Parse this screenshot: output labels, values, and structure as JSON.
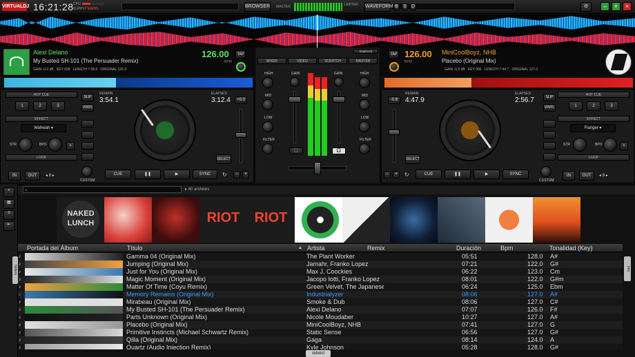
{
  "topbar": {
    "logo": "VIRTUALDJ",
    "clock": "16:21:28",
    "cpu": "CPU",
    "supply": "SUPPLY",
    "mains": "MAINS",
    "browser": "BROWSER",
    "master": "MASTER",
    "limiter": "LIMITER",
    "waveform": "WAVEFORM",
    "b": "B",
    "s": "S",
    "d": "D"
  },
  "deck_left": {
    "artist": "Alexi Delano",
    "title": "My Busted SH-101 (The Persuader Remix)",
    "bpm": "126.00",
    "bpm_label": "BPM",
    "tap": "TAP",
    "gain": "GAIN -0.0 dB",
    "key": "KEY",
    "key_val": "028",
    "length": "LENGTH",
    "length_val": "7:06.6",
    "original": "ORIGINAL",
    "original_val": "126.0",
    "remain_label": "REMAIN",
    "remain": "3:54.1",
    "elapsed_label": "ELAPSED",
    "elapsed": "3:12.4",
    "pitch": "+0.0"
  },
  "deck_right": {
    "artist": "MiniCoolBoyz, NHB",
    "title": "Placebo (Original Mix)",
    "bpm": "126.00",
    "bpm_label": "BPM",
    "tap": "TAP",
    "gain": "GAIN -0.0 dB",
    "key": "KEY",
    "key_val": "096",
    "length": "LENGTH",
    "length_val": "7:44.7",
    "original": "ORIGINAL",
    "original_val": "127.0",
    "remain_label": "REMAIN",
    "remain": "4:47.9",
    "elapsed_label": "ELAPSED",
    "elapsed": "2:56.7",
    "pitch": "-0.8"
  },
  "controls": {
    "hot_cue": "HOT CUE",
    "effect": "EFFECT",
    "loop": "LOOP",
    "slip": "SLIP",
    "vinyl": "VINYL",
    "sync_label": "SYNC",
    "cue": "CUE",
    "in": "IN",
    "out": "OUT",
    "custom": "CUSTOM",
    "select": "SELECT",
    "str": "STR",
    "bpo": "BPO",
    "effect_left": "Wahwah",
    "effect_right": "Flanger",
    "loop_val": "8",
    "hc1": "1",
    "hc2": "2",
    "hc3": "3"
  },
  "mixer": {
    "mixer": "MIXER",
    "video": "VIDEO",
    "scratch": "SCRATCH",
    "master": "MASTER",
    "high": "HIGH",
    "mid": "MID",
    "low": "LOW",
    "filter": "FILTER",
    "gain": "GAIN",
    "sampler": "SAMPLER"
  },
  "browser": {
    "archives": "40 archives",
    "sidelist": "sidelist",
    "folders": "folders",
    "info": "Info"
  },
  "columns": [
    "Portada del Álbum",
    "Título",
    "Artista",
    "Remix",
    "Duración",
    "Bpm",
    "Tonalidad (Key)"
  ],
  "tracks": [
    {
      "title": "Gamma 04 (Original Mix)",
      "artist": "The Plant Worker",
      "dur": "05:51",
      "bpm": "128.0",
      "key": "A#"
    },
    {
      "title": "Jumping (Original Mix)",
      "artist": "Jamahr, Franko Lopez",
      "dur": "07:21",
      "bpm": "122.0",
      "key": "G#"
    },
    {
      "title": "Just for You (Original Mix)",
      "artist": "Max J, Coockies",
      "dur": "06:22",
      "bpm": "123.0",
      "key": "Cm"
    },
    {
      "title": "Magic Moment (Original Mix)",
      "artist": "Jacopo Iotti, Franko Lopez",
      "dur": "08:01",
      "bpm": "122.0",
      "key": "G#m"
    },
    {
      "title": "Matter Of Time (Coyu Remix)",
      "artist": "Green Velvet, The Japanese...",
      "dur": "06:24",
      "bpm": "125.0",
      "key": "Ebm"
    },
    {
      "title": "Memory Remains (Original Mix)",
      "artist": "Industrialyzer",
      "dur": "08:06",
      "bpm": "127.0",
      "key": "A#"
    },
    {
      "title": "Mirabeau (Original Mix)",
      "artist": "Smoke & Dub",
      "dur": "08:06",
      "bpm": "127.0",
      "key": "C#"
    },
    {
      "title": "My Busted SH-101 (The Persuader Remix)",
      "artist": "Alexi Delano",
      "dur": "07:07",
      "bpm": "126.0",
      "key": "F#"
    },
    {
      "title": "Parts Unknown (Original Mix)",
      "artist": "Nicole Moudaber",
      "dur": "10:27",
      "bpm": "127.0",
      "key": "A#"
    },
    {
      "title": "Placebo (Original Mix)",
      "artist": "MiniCoolBoyz, NHB",
      "dur": "07:41",
      "bpm": "127.0",
      "key": "G"
    },
    {
      "title": "Primitive Instincts (Michael Schwartz Remix)",
      "artist": "Static Sense",
      "dur": "06:56",
      "bpm": "127.0",
      "key": "G#"
    },
    {
      "title": "Qilla (Original Mix)",
      "artist": "Gaga",
      "dur": "08:14",
      "bpm": "124.0",
      "key": "A"
    },
    {
      "title": "Quartz (Audio Injection Remix)",
      "artist": "Kyle Johnson",
      "dur": "05:28",
      "bpm": "128.0",
      "key": "G#"
    }
  ],
  "album_covers": [
    "naked-lunch",
    "red-texture",
    "dark-red",
    "riot-ep",
    "riot-ep-2",
    "green-vinyl",
    "bryan-chapman",
    "dark-blue-space",
    "alba",
    "orange-pattern",
    "sunset"
  ],
  "colors": {
    "accent_green": "#5de068",
    "accent_orange": "#f0a020",
    "highlight_blue": "#3a9cff"
  }
}
